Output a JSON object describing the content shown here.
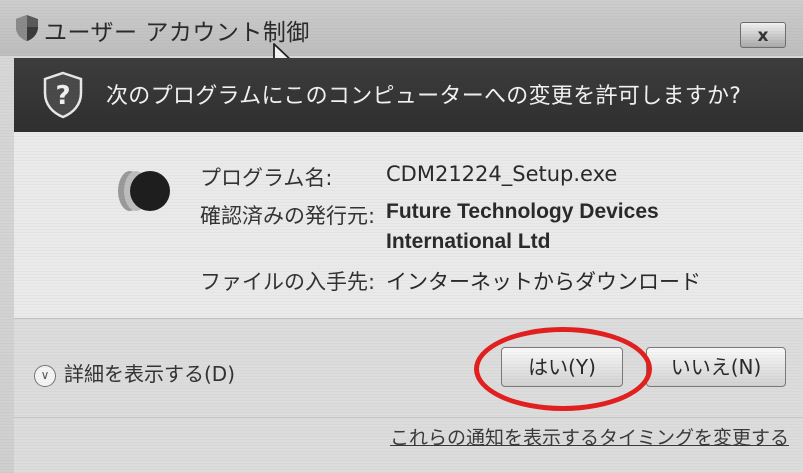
{
  "window": {
    "title": "ユーザー アカウント制御",
    "close_label": "x"
  },
  "header": {
    "question": "次のプログラムにこのコンピューターへの変更を許可しますか?"
  },
  "details": {
    "program_label": "プログラム名:",
    "program_value": "CDM21224_Setup.exe",
    "publisher_label": "確認済みの発行元:",
    "publisher_value_line1": "Future Technology Devices",
    "publisher_value_line2": "International Ltd",
    "source_label": "ファイルの入手先:",
    "source_value": "インターネットからダウンロード"
  },
  "footer": {
    "show_details": "詳細を表示する(D)",
    "yes_label": "はい(Y)",
    "no_label": "いいえ(N)",
    "link_text": "これらの通知を表示するタイミングを変更する"
  },
  "colors": {
    "header_bg": "#333333",
    "highlight_circle": "#e22020"
  },
  "icons": [
    "shield-icon",
    "question-shield-icon",
    "program-icon",
    "chevron-down-icon",
    "mouse-cursor-icon"
  ]
}
